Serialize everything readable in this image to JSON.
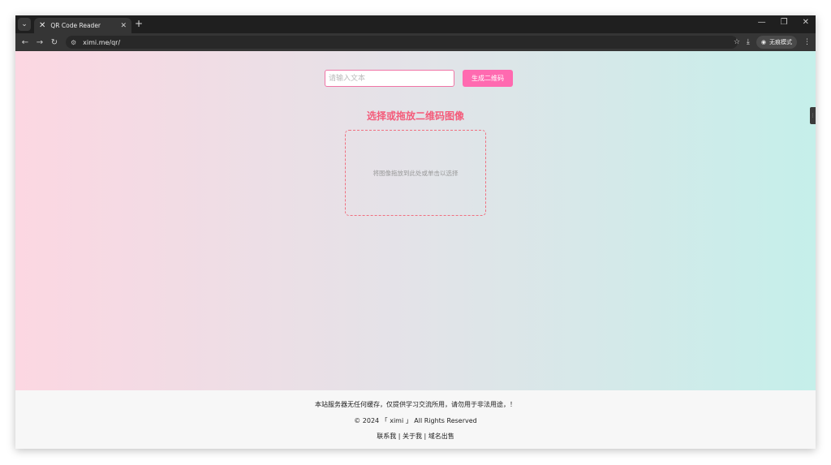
{
  "browser": {
    "tab_title": "QR Code Reader",
    "url": "ximi.me/qr/",
    "incognito_label": "无痕模式"
  },
  "generator": {
    "input_placeholder": "请输入文本",
    "button_label": "生成二维码"
  },
  "reader": {
    "title": "选择或拖放二维码图像",
    "dropzone_text": "将图像拖放到此处或单击以选择"
  },
  "footer": {
    "notice": "本站服务器无任何缓存，仅提供学习交流所用，请勿用于非法用途，！",
    "copyright": "© 2024 「 ximi 」 All Rights Reserved",
    "links": [
      "联系我",
      "关于我",
      "域名出售"
    ]
  }
}
